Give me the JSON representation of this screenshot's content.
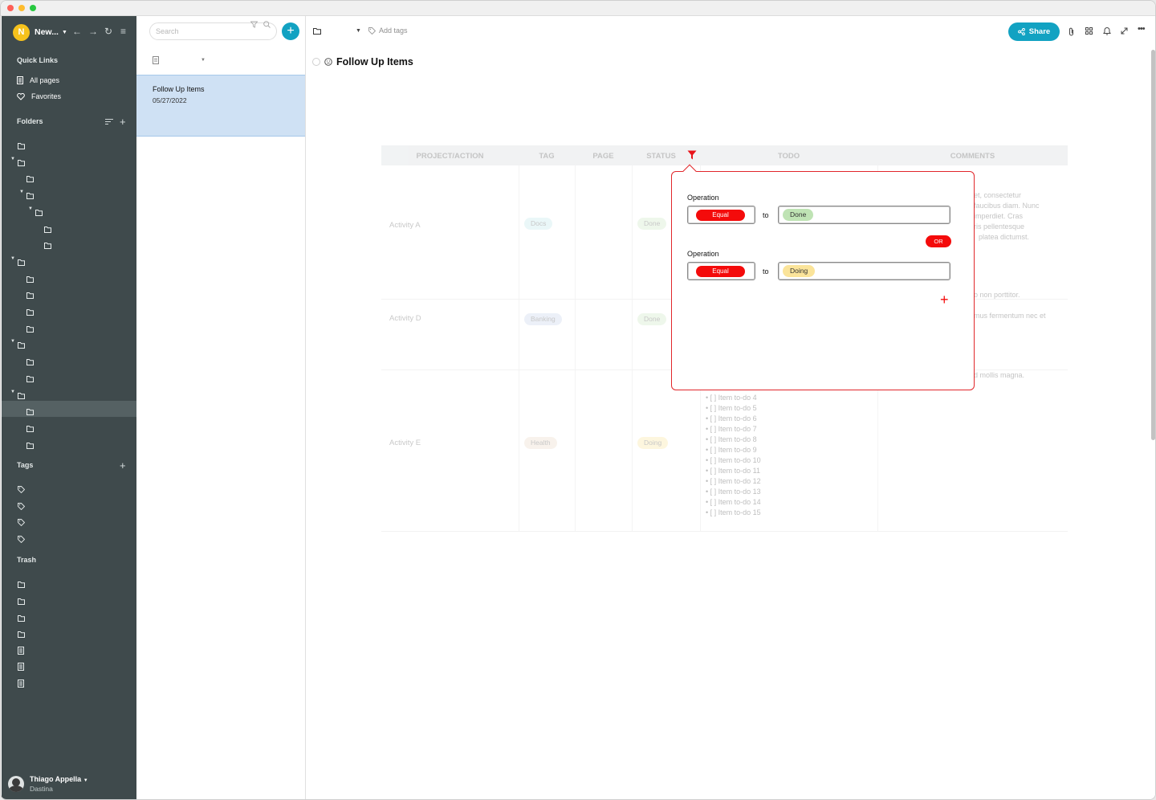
{
  "workspace": {
    "initial": "N",
    "name": "New...",
    "avatar_color": "#f6c21c"
  },
  "sidebar": {
    "quick_links_title": "Quick Links",
    "quick_links": [
      {
        "label": "All pages",
        "icon": "page-icon"
      },
      {
        "label": "Favorites",
        "icon": "heart-icon"
      }
    ],
    "folders_title": "Folders",
    "tags_title": "Tags",
    "trash_title": "Trash",
    "background": "#3f4a4c",
    "selected_background": "#556163"
  },
  "user": {
    "name": "Thiago Appella",
    "org": "Dastina"
  },
  "notelist": {
    "search_placeholder": "Search",
    "notes": [
      {
        "title": "Follow Up Items",
        "date": "05/27/2022"
      }
    ]
  },
  "toolbar": {
    "add_tags": "Add tags",
    "share_label": "Share",
    "accent": "#12a2c2"
  },
  "document": {
    "title": "Follow Up Items"
  },
  "table": {
    "headers": [
      "PROJECT/ACTION",
      "TAG",
      "PAGE",
      "STATUS",
      "TODO",
      "COMMENTS"
    ],
    "rows": [
      {
        "project": "Activity A",
        "tag": "Docs",
        "status": "Done",
        "comments": [
          "et, consectetur",
          "faucibus diam. Nunc",
          "imperdiet. Cras",
          "ris pellentesque",
          "platea dictumst."
        ]
      },
      {
        "project": "Activity D",
        "tag": "Banking",
        "status": "Done",
        "comments": [
          "o non porttitor.",
          "",
          "mus fermentum nec et"
        ]
      },
      {
        "project": "Activity E",
        "tag": "Health",
        "status": "Doing",
        "comments": [
          "d mollis magna."
        ],
        "todos": [
          "• [  ] Item to-do 4",
          "• [  ] Item to-do 5",
          "• [  ] Item to-do 6",
          "• [  ] Item to-do 7",
          "• [  ] Item to-do 8",
          "• [  ] Item to-do 9",
          "• [  ] Item to-do 10",
          "• [  ] Item to-do 11",
          "• [  ] Item to-do 12",
          "• [  ] Item to-do 13",
          "• [  ] Item to-do 14",
          "• [  ] Item to-do 15"
        ]
      }
    ]
  },
  "filter": {
    "accent": "#e1262a",
    "conditions": [
      {
        "label": "Operation",
        "operator": "Equal",
        "to": "to",
        "value": "Done",
        "value_color": "#bfe3b4"
      },
      {
        "label": "Operation",
        "operator": "Equal",
        "to": "to",
        "value": "Doing",
        "value_color": "#fbe49a"
      }
    ],
    "or_label": "OR",
    "add_label": "+"
  }
}
